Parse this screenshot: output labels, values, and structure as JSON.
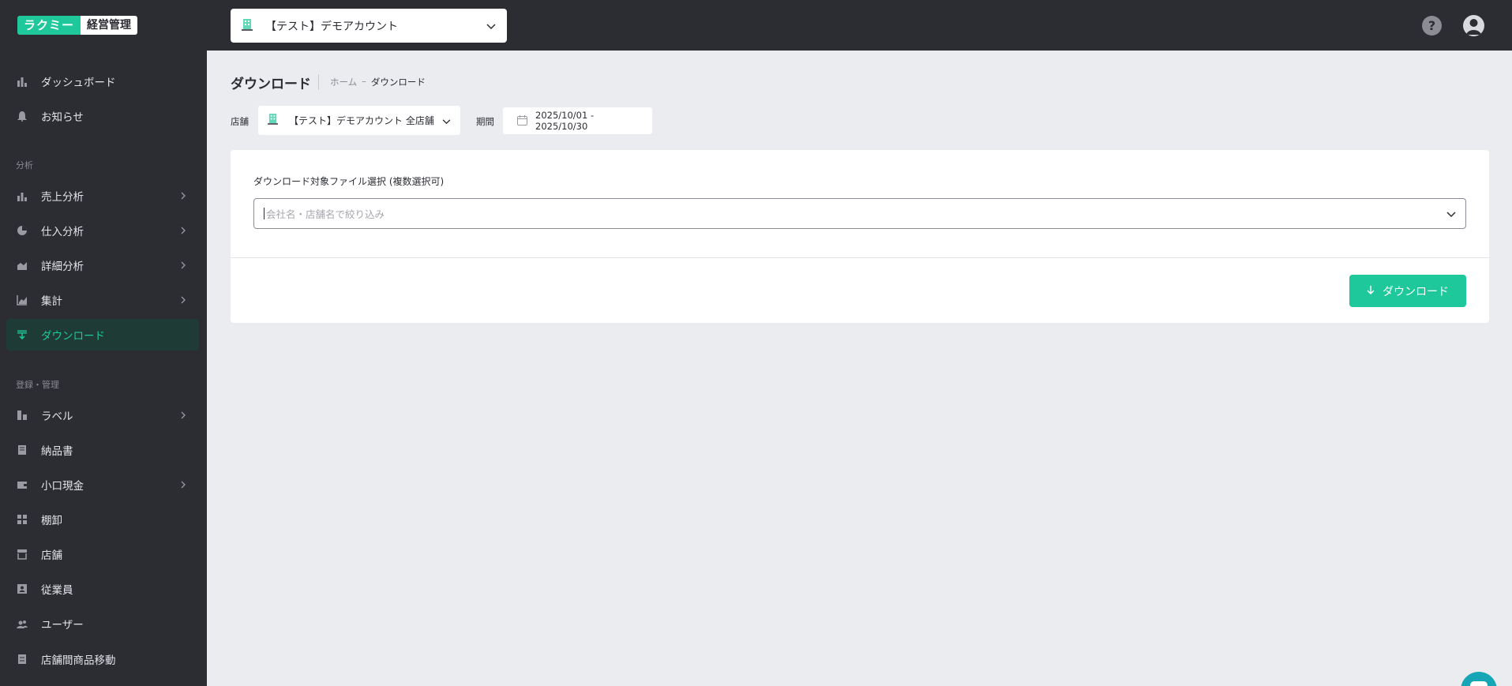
{
  "colors": {
    "topbar": "#2c2c33",
    "accent": "#1ec89a",
    "background": "#ebecf0",
    "active_nav_bg": "#1f3b36"
  },
  "header": {
    "logo_primary": "ラクミー",
    "logo_secondary": "経営管理",
    "account_name": "【テスト】デモアカウント",
    "help_label": "?"
  },
  "sidebar": {
    "top_items": [
      {
        "label": "ダッシュボード",
        "icon": "bar-chart-icon"
      },
      {
        "label": "お知らせ",
        "icon": "bell-icon"
      }
    ],
    "section_analysis": "分析",
    "analysis_items": [
      {
        "label": "売上分析",
        "icon": "bar-chart-icon",
        "has_submenu": true
      },
      {
        "label": "仕入分析",
        "icon": "pie-chart-icon",
        "has_submenu": true
      },
      {
        "label": "詳細分析",
        "icon": "area-chart-icon",
        "has_submenu": true
      },
      {
        "label": "集計",
        "icon": "line-chart-icon",
        "has_submenu": true
      },
      {
        "label": "ダウンロード",
        "icon": "download-icon",
        "active": true
      }
    ],
    "section_manage": "登録・管理",
    "manage_items": [
      {
        "label": "ラベル",
        "icon": "label-icon",
        "has_submenu": true
      },
      {
        "label": "納品書",
        "icon": "receipt-icon"
      },
      {
        "label": "小口現金",
        "icon": "wallet-icon",
        "has_submenu": true
      },
      {
        "label": "棚卸",
        "icon": "shelf-icon"
      },
      {
        "label": "店舗",
        "icon": "store-icon"
      },
      {
        "label": "従業員",
        "icon": "employee-icon"
      },
      {
        "label": "ユーザー",
        "icon": "users-icon"
      },
      {
        "label": "店舗間商品移動",
        "icon": "transfer-icon"
      }
    ]
  },
  "main": {
    "title": "ダウンロード",
    "breadcrumb": {
      "home": "ホーム",
      "sep": "–",
      "current": "ダウンロード"
    },
    "filters": {
      "store_label": "店舗",
      "store_value": "【テスト】デモアカウント 全店舗",
      "period_label": "期間",
      "period_value": "2025/10/01 - 2025/10/30"
    },
    "card": {
      "select_label": "ダウンロード対象ファイル選択 (複数選択可)",
      "select_placeholder": "会社名・店舗名で絞り込み",
      "download_button": "ダウンロード"
    }
  }
}
